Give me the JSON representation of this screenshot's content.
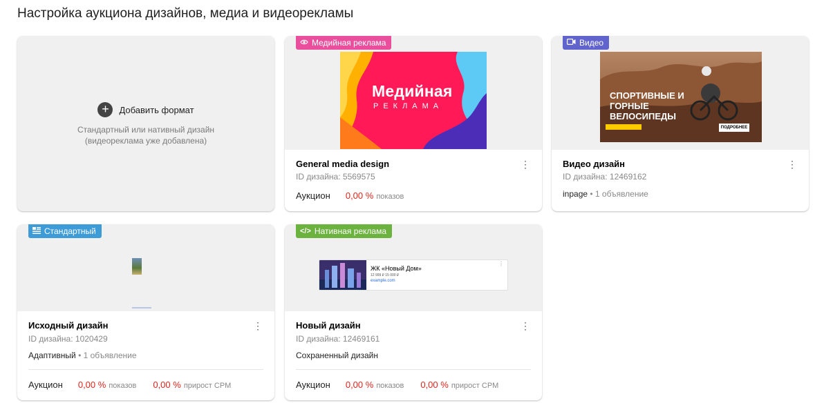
{
  "page": {
    "title": "Настройка аукциона дизайнов, медиа и видеорекламы"
  },
  "add_card": {
    "label": "Добавить формат",
    "desc_line1": "Стандартный или нативный дизайн",
    "desc_line2": "(видеореклама уже добавлена)"
  },
  "cards": [
    {
      "badge": "Медийная реклама",
      "badge_color": "#ea4f9d",
      "badge_icon": "eye-icon",
      "title": "General media design",
      "id_label": "ID дизайна:",
      "id_value": "5569575",
      "auction_label": "Аукцион",
      "shows_value": "0,00 %",
      "shows_unit": "показов",
      "preview": {
        "line1": "Медийная",
        "line2": "РЕКЛАМА"
      }
    },
    {
      "badge": "Видео",
      "badge_color": "#6264ce",
      "badge_icon": "video-camera-icon",
      "title": "Видео дизайн",
      "id_label": "ID дизайна:",
      "id_value": "12469162",
      "meta_main": "inpage",
      "meta_sub": "• 1 объявление",
      "preview": {
        "text": "СПОРТИВНЫЕ И ГОРНЫЕ ВЕЛОСИПЕДЫ",
        "button": "ПОДРОБНЕЕ"
      }
    },
    {
      "badge": "Стандартный",
      "badge_color": "#3d9bd8",
      "badge_icon": "layout-icon",
      "title": "Исходный дизайн",
      "id_label": "ID дизайна:",
      "id_value": "1020429",
      "meta_main": "Адаптивный",
      "meta_sub": "• 1 объявление",
      "auction_label": "Аукцион",
      "shows_value": "0,00 %",
      "shows_unit": "показов",
      "cpm_value": "0,00 %",
      "cpm_unit": "прирост CPM"
    },
    {
      "badge": "Нативная реклама",
      "badge_color": "#6cb23e",
      "badge_icon": "code-icon",
      "title": "Новый дизайн",
      "id_label": "ID дизайна:",
      "id_value": "12469161",
      "meta_main": "Сохраненный дизайн",
      "auction_label": "Аукцион",
      "shows_value": "0,00 %",
      "shows_unit": "показов",
      "cpm_value": "0,00 %",
      "cpm_unit": "прирост CPM",
      "preview": {
        "title": "ЖК «Новый Дом»",
        "price": "12 999 ₽ 15 000 ₽",
        "link": "example.com"
      }
    }
  ],
  "menu_icon": "more-vertical-icon"
}
